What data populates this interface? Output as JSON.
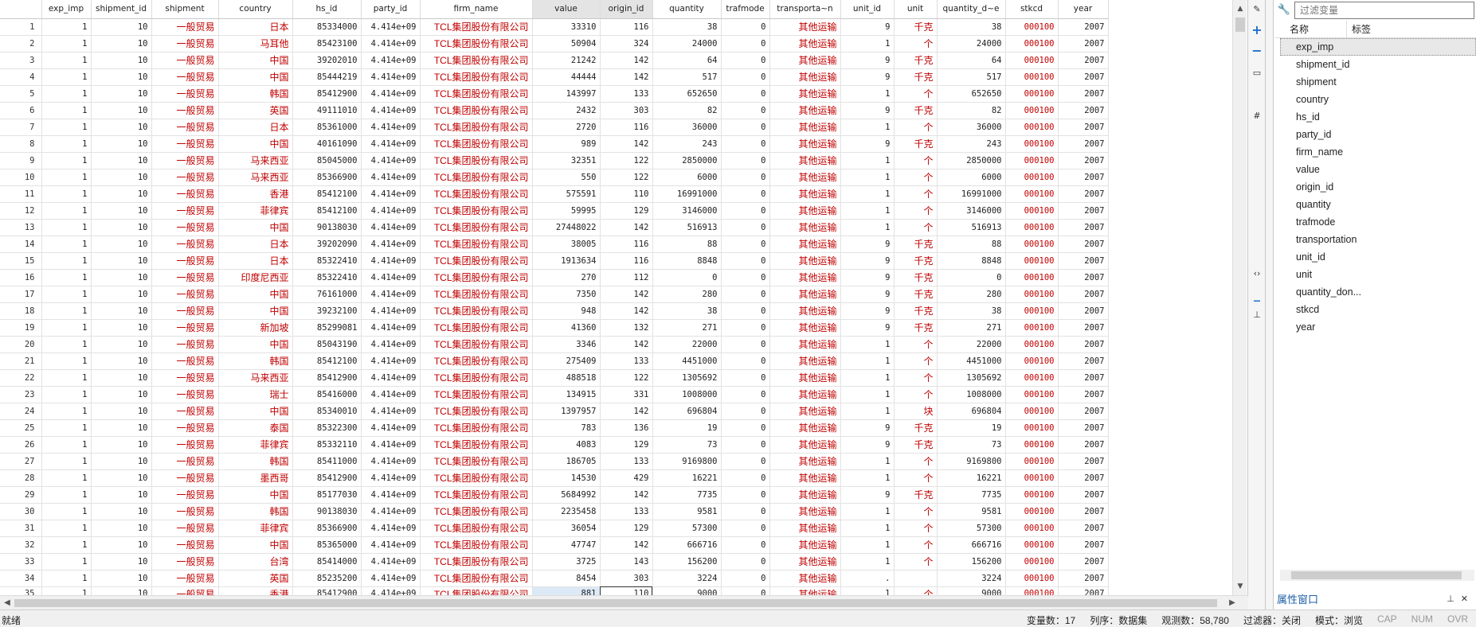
{
  "grid": {
    "columns": [
      "",
      "exp_imp",
      "shipment_id",
      "shipment",
      "country",
      "hs_id",
      "party_id",
      "firm_name",
      "value",
      "origin_id",
      "quantity",
      "trafmode",
      "transporta~n",
      "unit_id",
      "unit",
      "quantity_d~e",
      "stkcd",
      "year"
    ],
    "rows": [
      [
        "1",
        "1",
        "10",
        "一般贸易",
        "日本",
        "85334000",
        "4.414e+09",
        "TCL集团股份有限公司",
        "33310",
        "116",
        "38",
        "0",
        "其他运输",
        "9",
        "千克",
        "38",
        "000100",
        "2007"
      ],
      [
        "2",
        "1",
        "10",
        "一般贸易",
        "马耳他",
        "85423100",
        "4.414e+09",
        "TCL集团股份有限公司",
        "50904",
        "324",
        "24000",
        "0",
        "其他运输",
        "1",
        "个",
        "24000",
        "000100",
        "2007"
      ],
      [
        "3",
        "1",
        "10",
        "一般贸易",
        "中国",
        "39202010",
        "4.414e+09",
        "TCL集团股份有限公司",
        "21242",
        "142",
        "64",
        "0",
        "其他运输",
        "9",
        "千克",
        "64",
        "000100",
        "2007"
      ],
      [
        "4",
        "1",
        "10",
        "一般贸易",
        "中国",
        "85444219",
        "4.414e+09",
        "TCL集团股份有限公司",
        "44444",
        "142",
        "517",
        "0",
        "其他运输",
        "9",
        "千克",
        "517",
        "000100",
        "2007"
      ],
      [
        "5",
        "1",
        "10",
        "一般贸易",
        "韩国",
        "85412900",
        "4.414e+09",
        "TCL集团股份有限公司",
        "143997",
        "133",
        "652650",
        "0",
        "其他运输",
        "1",
        "个",
        "652650",
        "000100",
        "2007"
      ],
      [
        "6",
        "1",
        "10",
        "一般贸易",
        "英国",
        "49111010",
        "4.414e+09",
        "TCL集团股份有限公司",
        "2432",
        "303",
        "82",
        "0",
        "其他运输",
        "9",
        "千克",
        "82",
        "000100",
        "2007"
      ],
      [
        "7",
        "1",
        "10",
        "一般贸易",
        "日本",
        "85361000",
        "4.414e+09",
        "TCL集团股份有限公司",
        "2720",
        "116",
        "36000",
        "0",
        "其他运输",
        "1",
        "个",
        "36000",
        "000100",
        "2007"
      ],
      [
        "8",
        "1",
        "10",
        "一般贸易",
        "中国",
        "40161090",
        "4.414e+09",
        "TCL集团股份有限公司",
        "989",
        "142",
        "243",
        "0",
        "其他运输",
        "9",
        "千克",
        "243",
        "000100",
        "2007"
      ],
      [
        "9",
        "1",
        "10",
        "一般贸易",
        "马来西亚",
        "85045000",
        "4.414e+09",
        "TCL集团股份有限公司",
        "32351",
        "122",
        "2850000",
        "0",
        "其他运输",
        "1",
        "个",
        "2850000",
        "000100",
        "2007"
      ],
      [
        "10",
        "1",
        "10",
        "一般贸易",
        "马来西亚",
        "85366900",
        "4.414e+09",
        "TCL集团股份有限公司",
        "550",
        "122",
        "6000",
        "0",
        "其他运输",
        "1",
        "个",
        "6000",
        "000100",
        "2007"
      ],
      [
        "11",
        "1",
        "10",
        "一般贸易",
        "香港",
        "85412100",
        "4.414e+09",
        "TCL集团股份有限公司",
        "575591",
        "110",
        "16991000",
        "0",
        "其他运输",
        "1",
        "个",
        "16991000",
        "000100",
        "2007"
      ],
      [
        "12",
        "1",
        "10",
        "一般贸易",
        "菲律宾",
        "85412100",
        "4.414e+09",
        "TCL集团股份有限公司",
        "59995",
        "129",
        "3146000",
        "0",
        "其他运输",
        "1",
        "个",
        "3146000",
        "000100",
        "2007"
      ],
      [
        "13",
        "1",
        "10",
        "一般贸易",
        "中国",
        "90138030",
        "4.414e+09",
        "TCL集团股份有限公司",
        "27448022",
        "142",
        "516913",
        "0",
        "其他运输",
        "1",
        "个",
        "516913",
        "000100",
        "2007"
      ],
      [
        "14",
        "1",
        "10",
        "一般贸易",
        "日本",
        "39202090",
        "4.414e+09",
        "TCL集团股份有限公司",
        "38005",
        "116",
        "88",
        "0",
        "其他运输",
        "9",
        "千克",
        "88",
        "000100",
        "2007"
      ],
      [
        "15",
        "1",
        "10",
        "一般贸易",
        "日本",
        "85322410",
        "4.414e+09",
        "TCL集团股份有限公司",
        "1913634",
        "116",
        "8848",
        "0",
        "其他运输",
        "9",
        "千克",
        "8848",
        "000100",
        "2007"
      ],
      [
        "16",
        "1",
        "10",
        "一般贸易",
        "印度尼西亚",
        "85322410",
        "4.414e+09",
        "TCL集团股份有限公司",
        "270",
        "112",
        "0",
        "0",
        "其他运输",
        "9",
        "千克",
        "0",
        "000100",
        "2007"
      ],
      [
        "17",
        "1",
        "10",
        "一般贸易",
        "中国",
        "76161000",
        "4.414e+09",
        "TCL集团股份有限公司",
        "7350",
        "142",
        "280",
        "0",
        "其他运输",
        "9",
        "千克",
        "280",
        "000100",
        "2007"
      ],
      [
        "18",
        "1",
        "10",
        "一般贸易",
        "中国",
        "39232100",
        "4.414e+09",
        "TCL集团股份有限公司",
        "948",
        "142",
        "38",
        "0",
        "其他运输",
        "9",
        "千克",
        "38",
        "000100",
        "2007"
      ],
      [
        "19",
        "1",
        "10",
        "一般贸易",
        "新加坡",
        "85299081",
        "4.414e+09",
        "TCL集团股份有限公司",
        "41360",
        "132",
        "271",
        "0",
        "其他运输",
        "9",
        "千克",
        "271",
        "000100",
        "2007"
      ],
      [
        "20",
        "1",
        "10",
        "一般贸易",
        "中国",
        "85043190",
        "4.414e+09",
        "TCL集团股份有限公司",
        "3346",
        "142",
        "22000",
        "0",
        "其他运输",
        "1",
        "个",
        "22000",
        "000100",
        "2007"
      ],
      [
        "21",
        "1",
        "10",
        "一般贸易",
        "韩国",
        "85412100",
        "4.414e+09",
        "TCL集团股份有限公司",
        "275409",
        "133",
        "4451000",
        "0",
        "其他运输",
        "1",
        "个",
        "4451000",
        "000100",
        "2007"
      ],
      [
        "22",
        "1",
        "10",
        "一般贸易",
        "马来西亚",
        "85412900",
        "4.414e+09",
        "TCL集团股份有限公司",
        "488518",
        "122",
        "1305692",
        "0",
        "其他运输",
        "1",
        "个",
        "1305692",
        "000100",
        "2007"
      ],
      [
        "23",
        "1",
        "10",
        "一般贸易",
        "瑞士",
        "85416000",
        "4.414e+09",
        "TCL集团股份有限公司",
        "134915",
        "331",
        "1008000",
        "0",
        "其他运输",
        "1",
        "个",
        "1008000",
        "000100",
        "2007"
      ],
      [
        "24",
        "1",
        "10",
        "一般贸易",
        "中国",
        "85340010",
        "4.414e+09",
        "TCL集团股份有限公司",
        "1397957",
        "142",
        "696804",
        "0",
        "其他运输",
        "1",
        "块",
        "696804",
        "000100",
        "2007"
      ],
      [
        "25",
        "1",
        "10",
        "一般贸易",
        "泰国",
        "85322300",
        "4.414e+09",
        "TCL集团股份有限公司",
        "783",
        "136",
        "19",
        "0",
        "其他运输",
        "9",
        "千克",
        "19",
        "000100",
        "2007"
      ],
      [
        "26",
        "1",
        "10",
        "一般贸易",
        "菲律宾",
        "85332110",
        "4.414e+09",
        "TCL集团股份有限公司",
        "4083",
        "129",
        "73",
        "0",
        "其他运输",
        "9",
        "千克",
        "73",
        "000100",
        "2007"
      ],
      [
        "27",
        "1",
        "10",
        "一般贸易",
        "韩国",
        "85411000",
        "4.414e+09",
        "TCL集团股份有限公司",
        "186705",
        "133",
        "9169800",
        "0",
        "其他运输",
        "1",
        "个",
        "9169800",
        "000100",
        "2007"
      ],
      [
        "28",
        "1",
        "10",
        "一般贸易",
        "墨西哥",
        "85412900",
        "4.414e+09",
        "TCL集团股份有限公司",
        "14530",
        "429",
        "16221",
        "0",
        "其他运输",
        "1",
        "个",
        "16221",
        "000100",
        "2007"
      ],
      [
        "29",
        "1",
        "10",
        "一般贸易",
        "中国",
        "85177030",
        "4.414e+09",
        "TCL集团股份有限公司",
        "5684992",
        "142",
        "7735",
        "0",
        "其他运输",
        "9",
        "千克",
        "7735",
        "000100",
        "2007"
      ],
      [
        "30",
        "1",
        "10",
        "一般贸易",
        "韩国",
        "90138030",
        "4.414e+09",
        "TCL集团股份有限公司",
        "2235458",
        "133",
        "9581",
        "0",
        "其他运输",
        "1",
        "个",
        "9581",
        "000100",
        "2007"
      ],
      [
        "31",
        "1",
        "10",
        "一般贸易",
        "菲律宾",
        "85366900",
        "4.414e+09",
        "TCL集团股份有限公司",
        "36054",
        "129",
        "57300",
        "0",
        "其他运输",
        "1",
        "个",
        "57300",
        "000100",
        "2007"
      ],
      [
        "32",
        "1",
        "10",
        "一般贸易",
        "中国",
        "85365000",
        "4.414e+09",
        "TCL集团股份有限公司",
        "47747",
        "142",
        "666716",
        "0",
        "其他运输",
        "1",
        "个",
        "666716",
        "000100",
        "2007"
      ],
      [
        "33",
        "1",
        "10",
        "一般贸易",
        "台湾",
        "85414000",
        "4.414e+09",
        "TCL集团股份有限公司",
        "3725",
        "143",
        "156200",
        "0",
        "其他运输",
        "1",
        "个",
        "156200",
        "000100",
        "2007"
      ],
      [
        "34",
        "1",
        "10",
        "一般贸易",
        "英国",
        "85235200",
        "4.414e+09",
        "TCL集团股份有限公司",
        "8454",
        "303",
        "3224",
        "0",
        "其他运输",
        ".",
        "",
        "3224",
        "000100",
        "2007"
      ],
      [
        "35",
        "1",
        "10",
        "一般贸易",
        "香港",
        "85412900",
        "4.414e+09",
        "TCL集团股份有限公司",
        "881",
        "110",
        "9000",
        "0",
        "其他运输",
        "1",
        "个",
        "9000",
        "000100",
        "2007"
      ]
    ]
  },
  "variables_panel": {
    "filter_placeholder": "过滤变量",
    "header_name": "名称",
    "header_label": "标签",
    "items": [
      "exp_imp",
      "shipment_id",
      "shipment",
      "country",
      "hs_id",
      "party_id",
      "firm_name",
      "value",
      "origin_id",
      "quantity",
      "trafmode",
      "transportation",
      "unit_id",
      "unit",
      "quantity_don...",
      "stkcd",
      "year"
    ],
    "properties_label": "属性窗口"
  },
  "status": {
    "ready": "就绪",
    "vars": "变量数：17",
    "order": "列序：数据集",
    "obs": "观测数：58,780",
    "filter": "过滤器：关闭",
    "mode": "模式：浏览",
    "cap": "CAP",
    "num": "NUM",
    "num2": "NUM",
    "ovr": "OVR"
  },
  "colors": {
    "label_red": "#c00000",
    "accent_blue": "#1e6fc9"
  }
}
